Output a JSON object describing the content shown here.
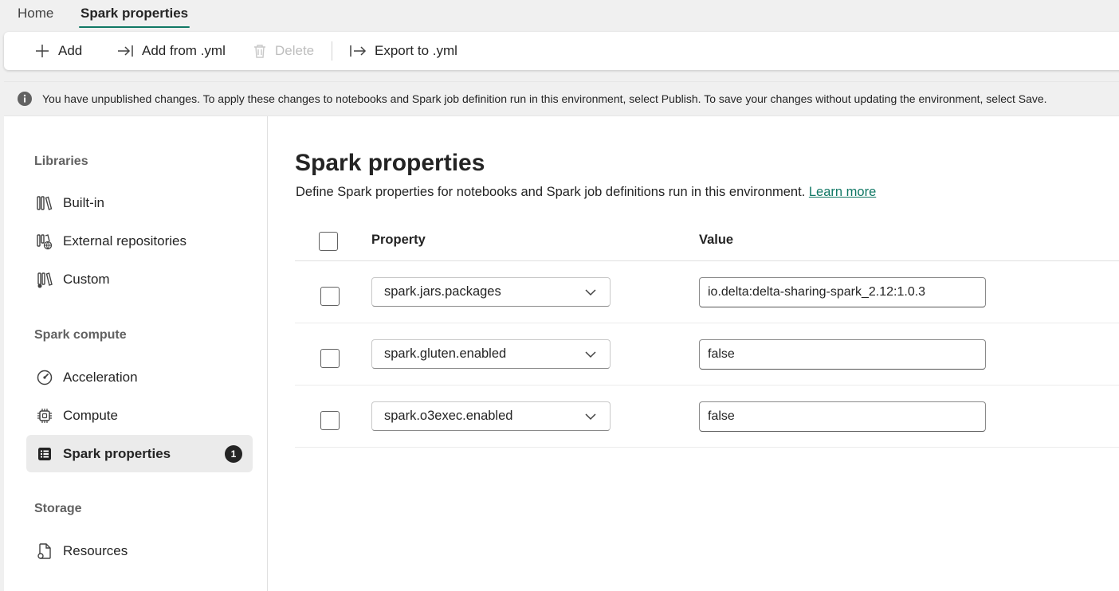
{
  "tabs": [
    {
      "label": "Home"
    },
    {
      "label": "Spark properties"
    }
  ],
  "toolbar": {
    "add_label": "Add",
    "add_from_yml_label": "Add from .yml",
    "delete_label": "Delete",
    "export_label": "Export to .yml"
  },
  "banner": {
    "message": "You have unpublished changes. To apply these changes to notebooks and Spark job definition run in this environment, select Publish. To save your changes without updating the environment, select Save."
  },
  "sidebar": {
    "sections": [
      {
        "title": "Libraries",
        "items": [
          {
            "label": "Built-in",
            "icon": "library-books-icon"
          },
          {
            "label": "External repositories",
            "icon": "library-globe-icon"
          },
          {
            "label": "Custom",
            "icon": "library-custom-icon"
          }
        ]
      },
      {
        "title": "Spark compute",
        "items": [
          {
            "label": "Acceleration",
            "icon": "gauge-icon"
          },
          {
            "label": "Compute",
            "icon": "chip-icon"
          },
          {
            "label": "Spark properties",
            "icon": "list-icon",
            "selected": true,
            "badge": "1"
          }
        ]
      },
      {
        "title": "Storage",
        "items": [
          {
            "label": "Resources",
            "icon": "document-icon"
          }
        ]
      }
    ]
  },
  "main": {
    "title": "Spark properties",
    "description": "Define Spark properties for notebooks and Spark job definitions run in this environment.",
    "learn_more": "Learn more",
    "columns": {
      "property": "Property",
      "value": "Value"
    },
    "rows": [
      {
        "property": "spark.jars.packages",
        "value": "io.delta:delta-sharing-spark_2.12:1.0.3"
      },
      {
        "property": "spark.gluten.enabled",
        "value": "false"
      },
      {
        "property": "spark.o3exec.enabled",
        "value": "false"
      }
    ]
  },
  "colors": {
    "accent": "#117865",
    "badge": "#242424",
    "selected_bg": "#ebebeb"
  }
}
